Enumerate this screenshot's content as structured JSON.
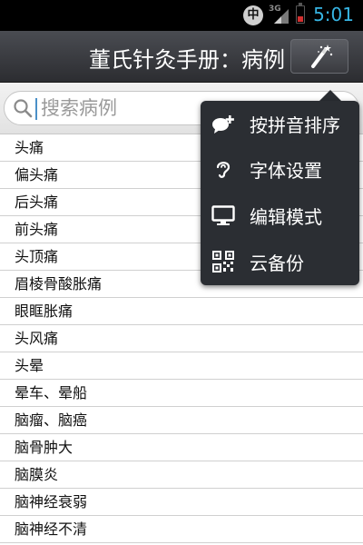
{
  "status_bar": {
    "ime_indicator": "中",
    "network": "3G",
    "time": "5:01",
    "icons": [
      "ime-icon",
      "signal-icon",
      "battery-icon"
    ]
  },
  "header": {
    "title": "董氏针灸手册：病例",
    "action_icon": "magic-wand-icon"
  },
  "search": {
    "placeholder": "搜索病例",
    "value": ""
  },
  "list": {
    "items": [
      "头痛",
      "偏头痛",
      "后头痛",
      "前头痛",
      "头顶痛",
      "眉棱骨酸胀痛",
      "眼眶胀痛",
      "头风痛",
      "头晕",
      "晕车、晕船",
      "脑瘤、脑癌",
      "脑骨肿大",
      "脑膜炎",
      "脑神经衰弱",
      "脑神经不清"
    ]
  },
  "menu": {
    "items": [
      {
        "label": "按拼音排序",
        "icon": "chat-add-icon"
      },
      {
        "label": "字体设置",
        "icon": "ear-icon"
      },
      {
        "label": "编辑模式",
        "icon": "monitor-icon"
      },
      {
        "label": "云备份",
        "icon": "qr-code-icon"
      }
    ]
  },
  "colors": {
    "status_bar": "#000000",
    "title_bar": "#3a3b40",
    "time_text": "#37b5e4",
    "menu_background": "#2b2e33",
    "battery_low": "#d32f2f"
  }
}
